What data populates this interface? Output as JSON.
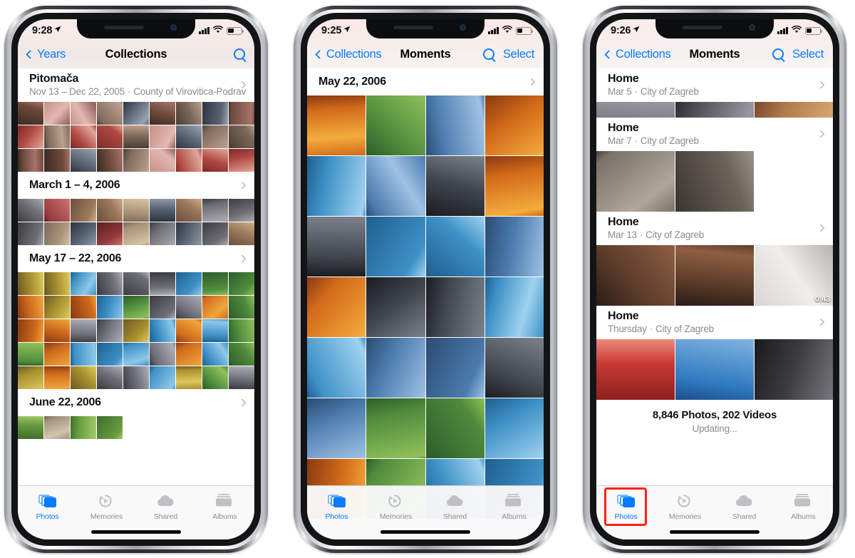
{
  "meta": {
    "accent_blue": "#0a7bff",
    "highlight_red": "#ff2116",
    "muted_gray": "#8e8e93"
  },
  "tabs": [
    {
      "label": "Photos",
      "icon": "photos-icon"
    },
    {
      "label": "Memories",
      "icon": "memories-icon"
    },
    {
      "label": "Shared",
      "icon": "shared-cloud-icon"
    },
    {
      "label": "Albums",
      "icon": "albums-icon"
    }
  ],
  "phones": [
    {
      "id": "phone-1",
      "status": {
        "time": "9:28",
        "location_icon": "location-arrow-icon",
        "signal": "signal-bars-icon",
        "wifi": "wifi-icon",
        "battery": "battery-icon",
        "battery_level": 45
      },
      "nav": {
        "back": "Years",
        "title": "Collections",
        "search_icon": "search-icon",
        "select": null
      },
      "sections": [
        {
          "title": "Pitomača",
          "subtitle_date": "Nov 13 – Dec 22, 2005",
          "subtitle_place": "County of Virovitica-Podrav",
          "rows": 3,
          "cols": 9
        },
        {
          "title": "March 1 – 4, 2006",
          "subtitle_date": null,
          "subtitle_place": null,
          "rows": 2,
          "cols": 9
        },
        {
          "title": "May 17 – 22, 2006",
          "subtitle_date": null,
          "subtitle_place": null,
          "rows": 5,
          "cols": 9
        },
        {
          "title": "June 22, 2006",
          "subtitle_date": null,
          "subtitle_place": null,
          "rows": 1,
          "cols": 9,
          "partial": 4
        }
      ],
      "footer": null,
      "tab_active": 0,
      "tab_highlighted": false
    },
    {
      "id": "phone-2",
      "status": {
        "time": "9:25",
        "location_icon": "location-arrow-icon",
        "signal": "signal-bars-icon",
        "wifi": "wifi-icon",
        "battery": "battery-icon",
        "battery_level": 40
      },
      "nav": {
        "back": "Collections",
        "title": "Moments",
        "search_icon": "search-icon",
        "select": "Select"
      },
      "sections": [
        {
          "title": "May 22, 2006",
          "subtitle_date": null,
          "subtitle_place": null,
          "rows": 7,
          "cols": 4
        }
      ],
      "footer": null,
      "tab_active": 0,
      "tab_highlighted": false
    },
    {
      "id": "phone-3",
      "status": {
        "time": "9:26",
        "location_icon": "location-arrow-icon",
        "signal": "signal-bars-icon",
        "wifi": "wifi-icon",
        "battery": "battery-icon",
        "battery_level": 38
      },
      "nav": {
        "back": "Collections",
        "title": "Moments",
        "search_icon": "search-icon",
        "select": "Select"
      },
      "sections": [
        {
          "title": "Home",
          "subtitle_date": "Mar 5",
          "subtitle_place": "City of Zagreb",
          "rows": 1,
          "cols": 3,
          "clipped_top": true
        },
        {
          "title": "Home",
          "subtitle_date": "Mar 7",
          "subtitle_place": "City of Zagreb",
          "rows": 1,
          "cols": 3,
          "partial": 2
        },
        {
          "title": "Home",
          "subtitle_date": "Mar 13",
          "subtitle_place": "City of Zagreb",
          "rows": 1,
          "cols": 3,
          "partial": 3,
          "video_badge": "0:43",
          "video_index": 2
        },
        {
          "title": "Home",
          "subtitle_date": "Thursday",
          "subtitle_place": "City of Zagreb",
          "rows": 1,
          "cols": 3,
          "partial": 3
        }
      ],
      "footer": {
        "count": "8,846 Photos, 202 Videos",
        "status": "Updating..."
      },
      "tab_active": 0,
      "tab_highlighted": true
    }
  ]
}
